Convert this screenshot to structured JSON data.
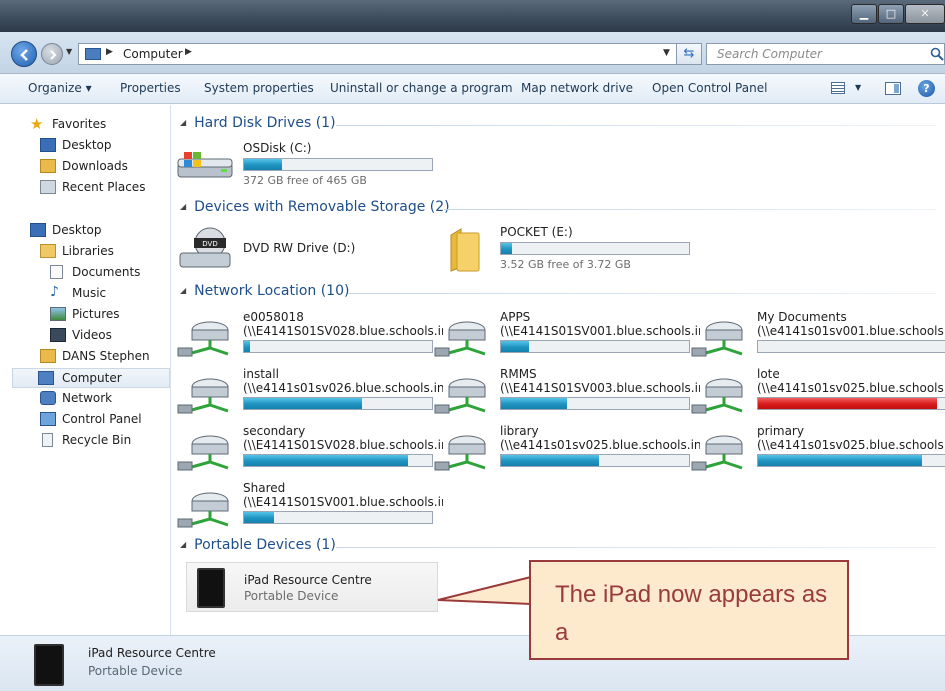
{
  "window": {
    "min_glyph": "▁",
    "max_glyph": "□",
    "close_glyph": "✕"
  },
  "address": {
    "path": "Computer",
    "search_placeholder": "Search Computer"
  },
  "toolbar": {
    "organize": "Organize ▾",
    "properties": "Properties",
    "system_properties": "System properties",
    "uninstall": "Uninstall or change a program",
    "map_drive": "Map network drive",
    "control_panel": "Open Control Panel",
    "help": "?"
  },
  "sidebar": {
    "favorites": "Favorites",
    "desktop_fav": "Desktop",
    "downloads": "Downloads",
    "recent": "Recent Places",
    "desktop": "Desktop",
    "libraries": "Libraries",
    "documents": "Documents",
    "music": "Music",
    "pictures": "Pictures",
    "videos": "Videos",
    "user": "DANS Stephen",
    "computer": "Computer",
    "network": "Network",
    "control_panel": "Control Panel",
    "recycle": "Recycle Bin"
  },
  "groups": {
    "hdd": "Hard Disk Drives (1)",
    "removable": "Devices with Removable Storage (2)",
    "network": "Network Location (10)",
    "portable": "Portable Devices (1)"
  },
  "hdd": {
    "name": "OSDisk (C:)",
    "free": "372 GB free of 465 GB",
    "used": 0.2
  },
  "removable": {
    "dvd_name": "DVD RW Drive (D:)",
    "pocket_name": "POCKET (E:)",
    "pocket_free": "3.52 GB free of 3.72 GB",
    "pocket_used": 0.06
  },
  "network": [
    {
      "name": "e0058018",
      "path": "(\\\\E4141S01SV028.blue.schools.in...",
      "used": 0.03
    },
    {
      "name": "APPS",
      "path": "(\\\\E4141S01SV001.blue.schools.in...",
      "used": 0.15
    },
    {
      "name": "My Documents",
      "path": "(\\\\e4141s01sv001.blue.schools.int...",
      "used": 0.0
    },
    {
      "name": "install",
      "path": "(\\\\e4141s01sv026.blue.schools.int...",
      "used": 0.63
    },
    {
      "name": "RMMS",
      "path": "(\\\\E4141S01SV003.blue.schools.in...",
      "used": 0.35
    },
    {
      "name": "lote",
      "path": "(\\\\e4141s01sv025.blue.schools.int...",
      "used": 0.95,
      "color": "red"
    },
    {
      "name": "secondary",
      "path": "(\\\\E4141S01SV028.blue.schools.in...",
      "used": 0.87
    },
    {
      "name": "library",
      "path": "(\\\\e4141s01sv025.blue.schools.int...",
      "used": 0.52
    },
    {
      "name": "primary",
      "path": "(\\\\e4141s01sv025.blue.schools.int...",
      "used": 0.87
    },
    {
      "name": "Shared",
      "path": "(\\\\E4141S01SV001.blue.schools.in...",
      "used": 0.16
    }
  ],
  "portable": {
    "name": "iPad Resource Centre",
    "sub": "Portable Device"
  },
  "details": {
    "name": "iPad Resource Centre",
    "sub": "Portable Device"
  },
  "callout": {
    "text": "The iPad now appears as a"
  },
  "colors": {
    "accent": "#1e4f8c",
    "bar_fill": "#1f93c0",
    "bar_warning": "#d81a1a",
    "callout_bg": "#fdeacc",
    "callout_border": "#9b3a3a"
  }
}
